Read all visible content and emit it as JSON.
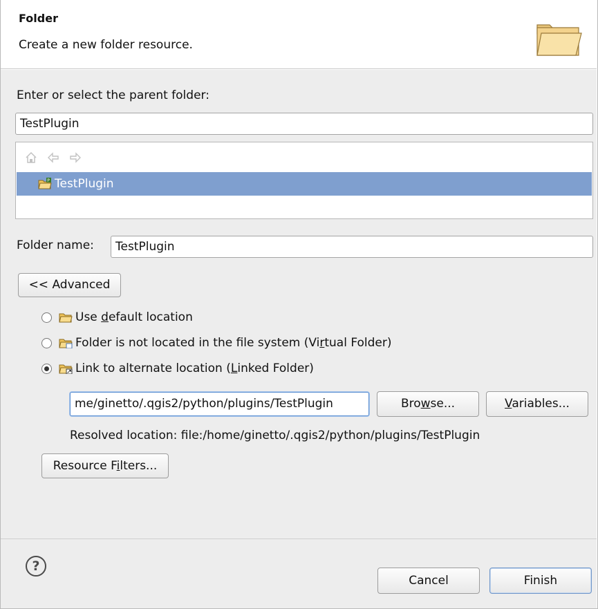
{
  "header": {
    "title": "Folder",
    "description": "Create a new folder resource.",
    "icon": "open-folder-icon"
  },
  "parent": {
    "label": "Enter or select the parent folder:",
    "value": "TestPlugin",
    "tree": {
      "toolbar": [
        "home-icon",
        "back-arrow-icon",
        "forward-arrow-icon"
      ],
      "items": [
        {
          "label": "TestPlugin",
          "icon": "project-folder-icon",
          "selected": true
        }
      ]
    }
  },
  "folder_name": {
    "label": "Folder name:",
    "value": "TestPlugin"
  },
  "advanced_button": "<< Advanced",
  "location": {
    "options": [
      {
        "pre": "Use ",
        "mn": "d",
        "post": "efault location",
        "checked": false
      },
      {
        "pre": "Folder is not located in the file system (Vi",
        "mn": "r",
        "post": "tual Folder)",
        "checked": false
      },
      {
        "pre": "",
        "mn": "",
        "post": "",
        "checked": true
      }
    ],
    "linked": {
      "pre": "Link to alternate location (",
      "mn": "L",
      "post": "inked Folder)"
    },
    "path_value": "me/ginetto/.qgis2/python/plugins/TestPlugin",
    "browse": {
      "pre": "Bro",
      "mn": "w",
      "post": "se..."
    },
    "variables": {
      "pre": "",
      "mn": "V",
      "post": "ariables..."
    },
    "resolved": "Resolved location: file:/home/ginetto/.qgis2/python/plugins/TestPlugin"
  },
  "resource_filters": {
    "pre": "Resource F",
    "mn": "i",
    "post": "lters..."
  },
  "footer": {
    "help_symbol": "?",
    "cancel": "Cancel",
    "finish": "Finish"
  },
  "colors": {
    "selection": "#7f9fcf",
    "background": "#ededed",
    "focus": "#5b8fd1"
  }
}
